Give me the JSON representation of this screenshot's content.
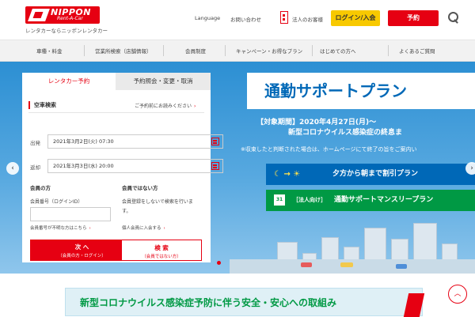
{
  "header": {
    "logo_name": "NIPPON",
    "logo_sub": "Rent-A-Car",
    "logo_tagline": "レンタカーならニッポンレンタカー",
    "language": "Language",
    "contact": "お問い合わせ",
    "corporate": "法人のお客様",
    "login": "ログイン/入会",
    "reserve": "予約"
  },
  "nav": {
    "items": [
      "車種・料金",
      "営業所検索（店舗情報）",
      "会員制度",
      "キャンペーン・お得なプラン",
      "はじめての方へ",
      "よくあるご質問"
    ]
  },
  "booking": {
    "tab_reserve": "レンタカー予約",
    "tab_manage": "予約照会・変更・取消",
    "section_title": "空車検索",
    "hint": "ご予約前にお読みください",
    "depart_label": "出発",
    "depart_value": "2021年3月2日(火) 07:30",
    "return_label": "返却",
    "return_value": "2021年3月3日(水) 20:00",
    "member_title": "会員の方",
    "member_id_label": "会員番号（ログインID）",
    "member_id_placeholder": "",
    "forgot_link": "会員番号が不明な方はこちら",
    "nonmember_title": "会員ではない方",
    "nonmember_text1": "会員登録をしないで検索を行いま",
    "nonmember_text2": "す。",
    "join_link": "個人会員に入会する",
    "next_main": "次 へ",
    "next_sub": "（会員の方・ログイン）",
    "search_main": "検 索",
    "search_sub": "（会員ではない方）"
  },
  "promo": {
    "title": "通勤サポートプラン",
    "period1": "【対象期間】2020年4月27日(月)～",
    "period2": "新型コロナウイルス感染症の終息ま",
    "note": "※収束したと判断された場合は、ホームページにて終了の旨をご案内い",
    "plan1": "夕方から朝まで割引プラン",
    "plan1_icons": "☾ → ☀",
    "plan2_tag": "［法人向け］",
    "plan2": "通勤サポートマンスリープラン",
    "calendar_day": "31"
  },
  "notice": {
    "text": "新型コロナウイルス感染症予防に伴う安全・安心への取組み"
  },
  "controls": {
    "prev": "‹",
    "next": "›",
    "top": "︿"
  },
  "colors": {
    "brand_red": "#e60012",
    "accent_yellow": "#f8c900",
    "promo_blue": "#0068b7",
    "promo_green": "#009944"
  }
}
